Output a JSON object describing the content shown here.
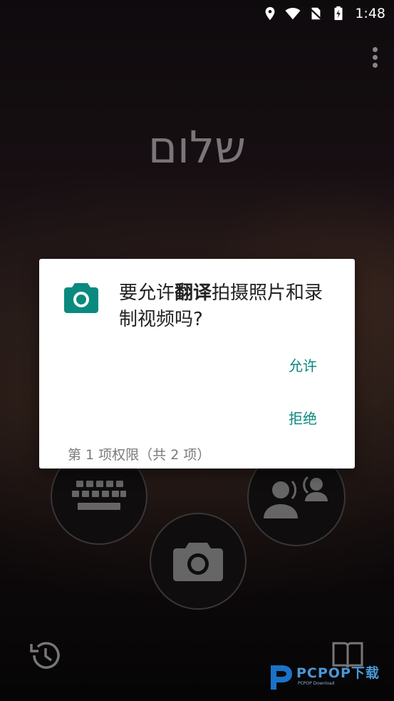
{
  "status_bar": {
    "time": "1:48",
    "icons": [
      "location-icon",
      "wifi-icon",
      "no-sim-icon",
      "battery-icon"
    ]
  },
  "app": {
    "phrase": "שלום"
  },
  "dialog": {
    "message_prefix": "要允许",
    "app_name": "翻译",
    "message_suffix": "拍摄照片和录制视频吗?",
    "allow_label": "允许",
    "deny_label": "拒绝",
    "counter": "第 1 项权限（共 2 项）",
    "icon": "camera-icon"
  },
  "colors": {
    "accent": "#0a8a7e",
    "dialog_bg": "#ffffff"
  },
  "watermark": {
    "brand": "PCPOP下载",
    "sub": "PCPOP Download"
  }
}
